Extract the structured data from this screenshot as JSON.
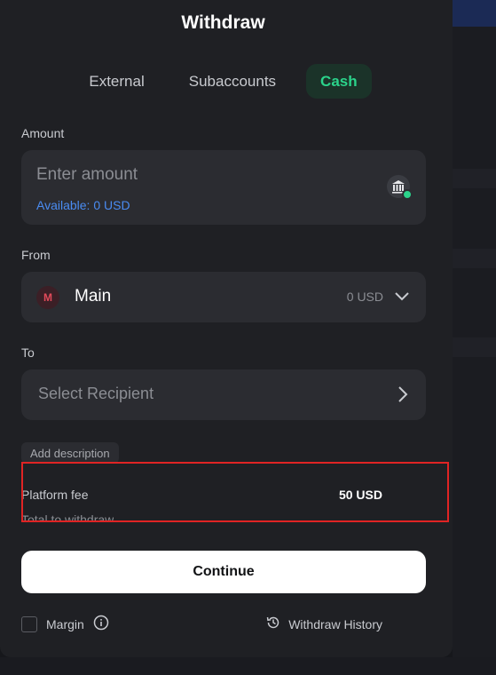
{
  "modal": {
    "title": "Withdraw",
    "tabs": [
      {
        "label": "External",
        "active": false
      },
      {
        "label": "Subaccounts",
        "active": false
      },
      {
        "label": "Cash",
        "active": true
      }
    ]
  },
  "amount": {
    "label": "Amount",
    "placeholder": "Enter amount",
    "available": "Available: 0 USD",
    "icon": "bank-icon"
  },
  "from": {
    "label": "From",
    "avatar_letter": "M",
    "account_name": "Main",
    "balance": "0 USD",
    "icon": "chevron-down-icon"
  },
  "to": {
    "label": "To",
    "placeholder": "Select Recipient",
    "icon": "chevron-right-icon"
  },
  "description": {
    "button_label": "Add description"
  },
  "fees": {
    "platform_fee_label": "Platform fee",
    "platform_fee_value": "50 USD",
    "total_label": "Total to withdraw"
  },
  "actions": {
    "continue_label": "Continue",
    "margin_label": "Margin",
    "margin_checked": false,
    "history_label": "Withdraw History"
  },
  "colors": {
    "accent_green": "#2bd38b",
    "link_blue": "#4a8cf2",
    "highlight_red": "#e02424"
  }
}
